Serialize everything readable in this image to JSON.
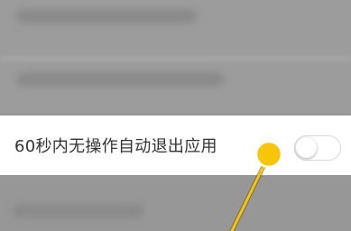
{
  "settings": {
    "auto_exit": {
      "label": "60秒内无操作自动退出应用",
      "enabled": false
    }
  },
  "colors": {
    "tap_indicator": "#f7c60b",
    "blurred_background": "#9a9a9a",
    "row_background": "#ffffff"
  }
}
